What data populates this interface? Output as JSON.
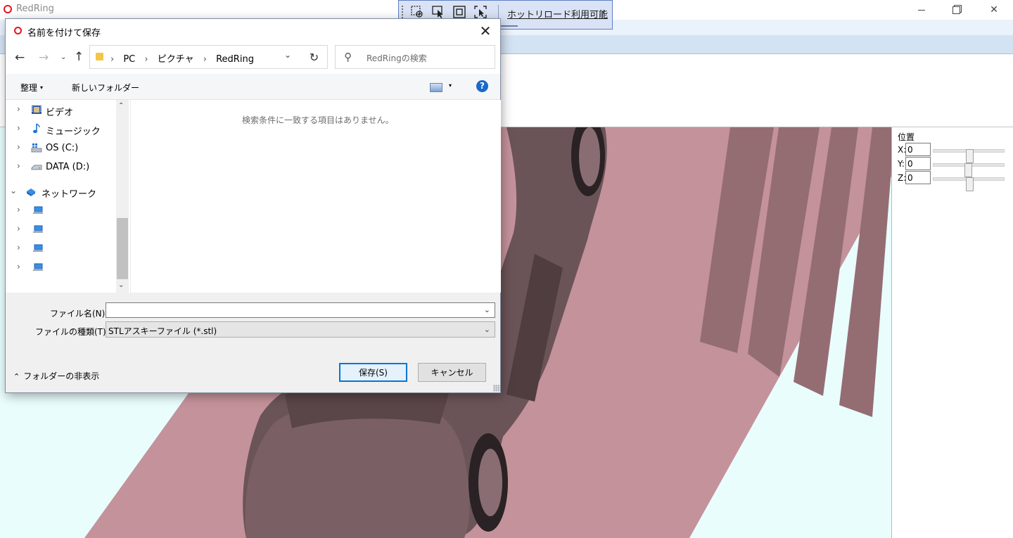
{
  "main_window": {
    "title": "RedRing",
    "controls": {
      "minimize": "",
      "maximize": "",
      "close": "✕"
    }
  },
  "hot_reload_bar": {
    "text": "ホットリロード利用可能",
    "chevron": "‹",
    "icons": [
      "select-element-icon",
      "pointer-select-icon",
      "display-layout-icon",
      "track-focus-icon"
    ]
  },
  "position_panel": {
    "title": "位置",
    "axes": [
      {
        "label": "X:",
        "value": "0",
        "slider": 0.5
      },
      {
        "label": "Y:",
        "value": "0",
        "slider": 0.5
      },
      {
        "label": "Z:",
        "value": "0",
        "slider": 0.5
      }
    ]
  },
  "dialog": {
    "title": "名前を付けて保存",
    "close": "✕",
    "nav": {
      "back": "←",
      "forward": "→",
      "recent": "⌄",
      "up": "↑",
      "refresh": "↻"
    },
    "breadcrumbs": [
      "PC",
      "ピクチャ",
      "RedRing"
    ],
    "crumb_sep": "›",
    "address_dropdown": "⌄",
    "search_placeholder": "RedRingの検索",
    "toolbar": {
      "organize": "整理",
      "organize_caret": "▾",
      "new_folder": "新しいフォルダー",
      "view_caret": "▾",
      "help": "?"
    },
    "tree": [
      {
        "label": "ビデオ",
        "icon": "video-folder-icon",
        "arrow": "›"
      },
      {
        "label": "ミュージック",
        "icon": "music-note-icon",
        "arrow": "›"
      },
      {
        "label": "OS (C:)",
        "icon": "os-drive-icon",
        "arrow": "›"
      },
      {
        "label": "DATA (D:)",
        "icon": "data-drive-icon",
        "arrow": "›"
      },
      {
        "label": "ネットワーク",
        "icon": "network-icon",
        "arrow": "⌄"
      },
      {
        "label": "",
        "icon": "computer-icon",
        "arrow": "›"
      },
      {
        "label": "",
        "icon": "computer-icon",
        "arrow": "›"
      },
      {
        "label": "",
        "icon": "computer-icon",
        "arrow": "›"
      },
      {
        "label": "",
        "icon": "computer-icon",
        "arrow": "›"
      }
    ],
    "scroll": {
      "up": "⌃",
      "down": "⌄"
    },
    "empty_message": "検索条件に一致する項目はありません。",
    "filename": {
      "label": "ファイル名(N):",
      "value": "",
      "dropdown": "⌄"
    },
    "filetype": {
      "label": "ファイルの種類(T):",
      "value": "STLアスキーファイル (*.stl)",
      "dropdown": "⌄"
    },
    "hide_folders": {
      "chevron": "⌃",
      "label": "フォルダーの非表示"
    },
    "save_button": "保存(S)",
    "cancel_button": "キャンセル"
  },
  "colors": {
    "ground": "#c4929b",
    "bars": "#946d73",
    "car": "#6b5458",
    "background": "#e9fdfd",
    "accent": "#0078d7"
  }
}
